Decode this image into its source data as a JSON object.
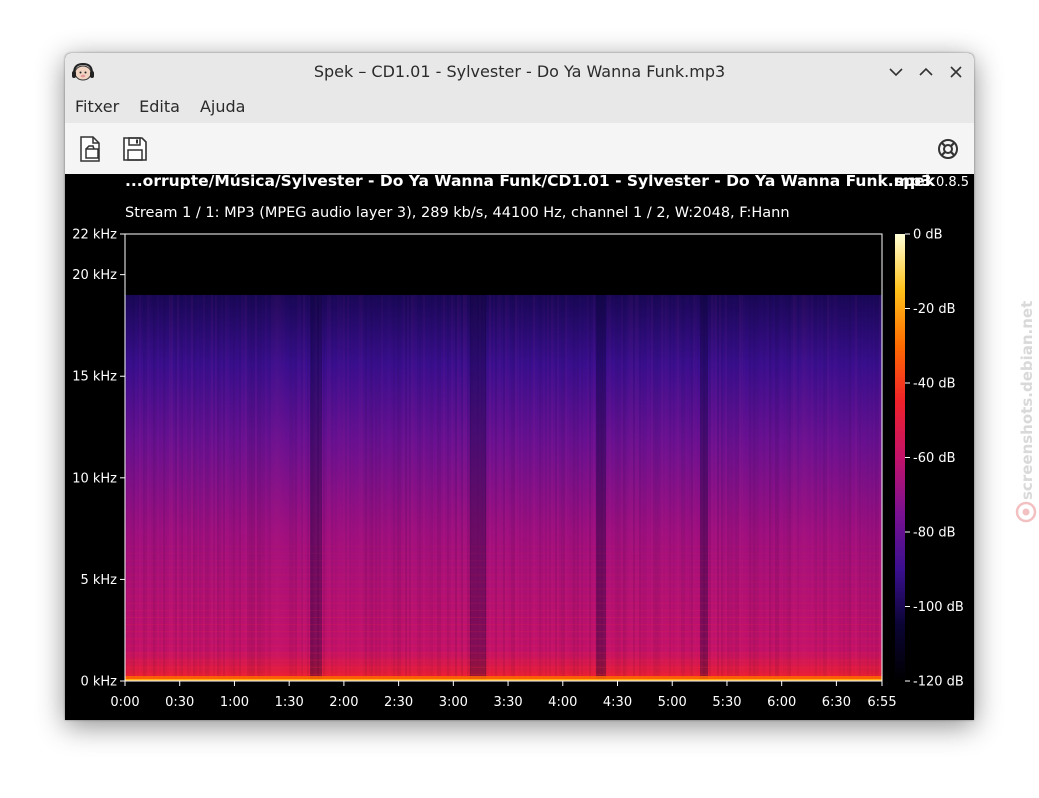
{
  "window": {
    "title": "Spek – CD1.01 - Sylvester - Do Ya Wanna Funk.mp3"
  },
  "menu": {
    "items": [
      "Fitxer",
      "Edita",
      "Ajuda"
    ]
  },
  "icons": {
    "app": "spek-headphones-icon",
    "open": "open-file-icon",
    "save": "save-icon",
    "help": "lifebuoy-icon",
    "minimize": "chevron-down-icon",
    "maximize": "chevron-up-icon",
    "close": "close-icon"
  },
  "spectrogram": {
    "file_path": "...orrupte/Música/Sylvester - Do Ya Wanna Funk/CD1.01 - Sylvester - Do Ya Wanna Funk.mp3",
    "brand": "spek",
    "version": "0.8.5",
    "stream_info": "Stream 1 / 1: MP3 (MPEG audio layer 3), 289 kb/s, 44100 Hz, channel 1 / 2, W:2048, F:Hann",
    "freq_labels": [
      {
        "label": "22 kHz",
        "khz": 22
      },
      {
        "label": "20 kHz",
        "khz": 20
      },
      {
        "label": "15 kHz",
        "khz": 15
      },
      {
        "label": "10 kHz",
        "khz": 10
      },
      {
        "label": "5 kHz",
        "khz": 5
      },
      {
        "label": "0 kHz",
        "khz": 0
      }
    ],
    "freq_max_khz": 22,
    "cutoff_khz": 19,
    "time_labels": [
      "0:00",
      "0:30",
      "1:00",
      "1:30",
      "2:00",
      "2:30",
      "3:00",
      "3:30",
      "4:00",
      "4:30",
      "5:00",
      "5:30",
      "6:00",
      "6:30",
      "6:55"
    ],
    "duration_sec": 415,
    "db_labels": [
      {
        "label": "0 dB",
        "db": 0
      },
      {
        "label": "-20 dB",
        "db": -20
      },
      {
        "label": "-40 dB",
        "db": -40
      },
      {
        "label": "-60 dB",
        "db": -60
      },
      {
        "label": "-80 dB",
        "db": -80
      },
      {
        "label": "-100 dB",
        "db": -100
      },
      {
        "label": "-120 dB",
        "db": -120
      }
    ],
    "db_min": -120,
    "db_max": 0,
    "colormap": [
      "#000000",
      "#0a0433",
      "#3a0f8f",
      "#7a1191",
      "#c3126a",
      "#f0212a",
      "#ff6a00",
      "#ffc21a",
      "#ffffd9"
    ]
  },
  "watermark": {
    "text": "screenshots.debian.net"
  }
}
